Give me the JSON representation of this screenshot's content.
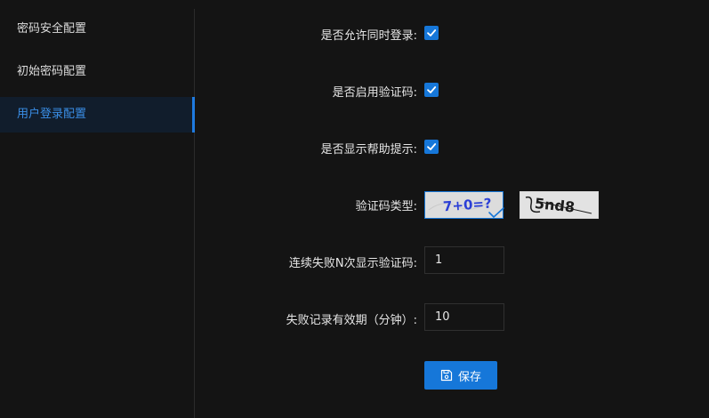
{
  "sidebar": {
    "items": [
      {
        "label": "密码安全配置",
        "active": false
      },
      {
        "label": "初始密码配置",
        "active": false
      },
      {
        "label": "用户登录配置",
        "active": true
      }
    ]
  },
  "form": {
    "allow_concurrent_login": {
      "label": "是否允许同时登录:",
      "checked": true
    },
    "enable_captcha": {
      "label": "是否启用验证码:",
      "checked": true
    },
    "show_help_hint": {
      "label": "是否显示帮助提示:",
      "checked": true
    },
    "captcha_type": {
      "label": "验证码类型:",
      "options": [
        {
          "text": "7+0=?",
          "selected": true
        },
        {
          "text": "5nd8",
          "selected": false
        }
      ]
    },
    "failures_before_captcha": {
      "label": "连续失败N次显示验证码:",
      "value": "1"
    },
    "failure_record_validity": {
      "label": "失败记录有效期（分钟）:",
      "value": "10"
    },
    "save_button": {
      "label": "保存",
      "icon": "save-icon"
    }
  },
  "colors": {
    "background": "#141414",
    "accent": "#1677d9",
    "active_item_bg": "#111d2c",
    "active_item_text": "#3a8ee6"
  }
}
